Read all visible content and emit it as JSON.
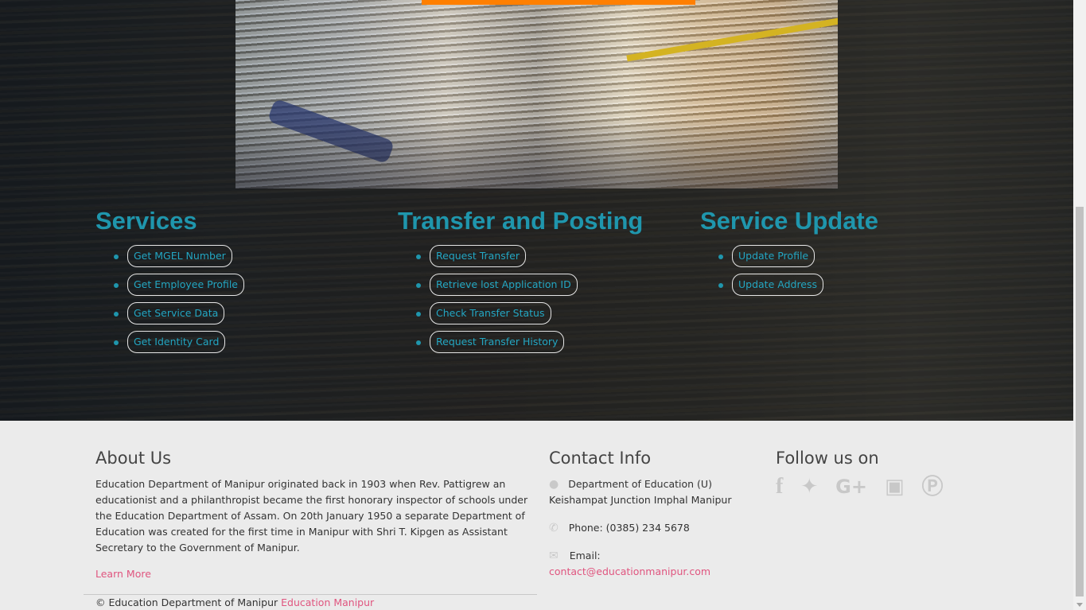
{
  "hero": {
    "accent_color": "#ff7f00"
  },
  "services": {
    "title": "Services",
    "items": [
      "Get MGEL Number",
      "Get Employee Profile",
      "Get Service Data",
      "Get Identity Card"
    ]
  },
  "transfer": {
    "title": "Transfer and Posting",
    "items": [
      "Request Transfer",
      "Retrieve lost Application ID",
      "Check Transfer Status",
      "Request Transfer History"
    ]
  },
  "service_update": {
    "title": "Service Update",
    "items": [
      "Update Profile",
      "Update Address"
    ]
  },
  "footer": {
    "about": {
      "title": "About Us",
      "text": "Education Department of Manipur originated back in 1903 when Rev. Pattigrew an educationist and a philanthropist became the first honorary inspector of schools under the Education Department of Assam. On 20th January 1950 a separate Department of Education was created for the first time in Manipur with Shri T. Kipgen as Assistant Secretary to the Government of Manipur.",
      "learn_more": "Learn More"
    },
    "copyright": {
      "text": "© Education Department of Manipur",
      "link": "Education Manipur"
    },
    "contact": {
      "title": "Contact Info",
      "address_line1": "Department of Education (U)",
      "address_line2": "Keishampat Junction Imphal Manipur",
      "phone": "Phone: (0385) 234 5678",
      "email_label": "Email:",
      "email": "contact@educationmanipur.com"
    },
    "follow": {
      "title": "Follow us on",
      "icons": [
        "facebook-icon",
        "twitter-icon",
        "google-plus-icon",
        "instagram-icon",
        "pinterest-icon"
      ]
    }
  },
  "colors": {
    "heading": "#1f96ad",
    "pill_text": "#23a6c2",
    "link": "#e0557f",
    "footer_bg": "#ebebeb"
  }
}
